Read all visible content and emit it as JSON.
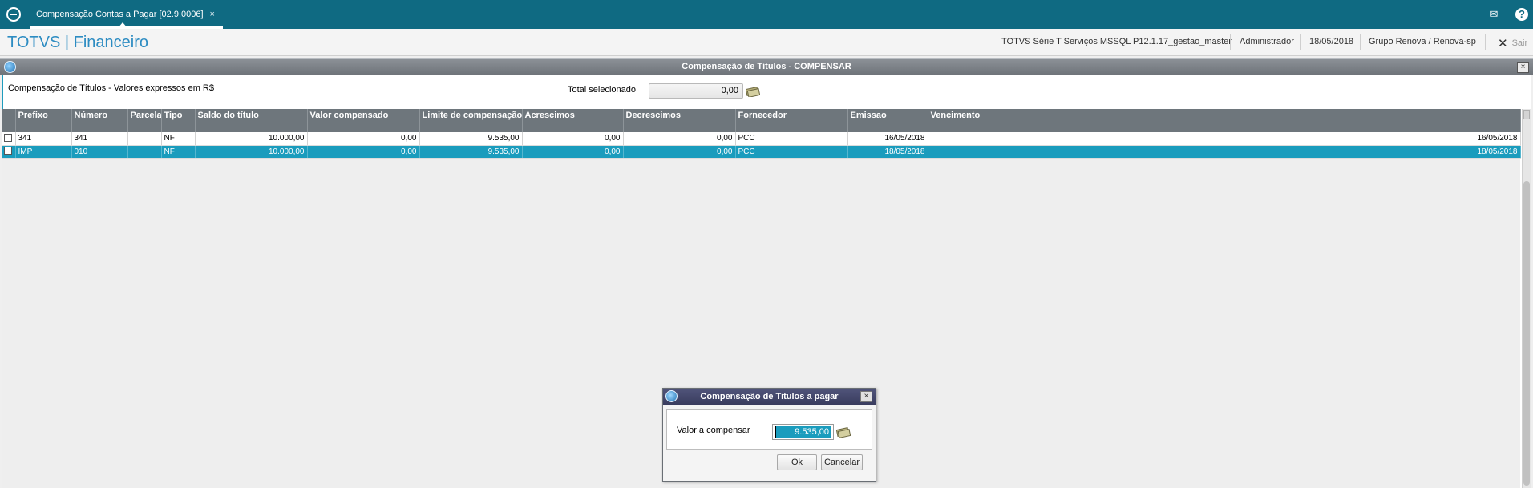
{
  "topbar": {
    "tab_label": "Compensação Contas a Pagar [02.9.0006]",
    "tab_close": "×",
    "mail_icon": "✉",
    "help_icon": "?"
  },
  "header": {
    "brand": "TOTVS | Financeiro",
    "env": "TOTVS Série T Serviços MSSQL P12.1.17_gestao_master",
    "user": "Administrador",
    "date": "18/05/2018",
    "company": "Grupo Renova / Renova-sp",
    "logout": "Sair"
  },
  "window": {
    "title": "Compensação de Títulos - COMPENSAR",
    "close": "×",
    "subtitle": "Compensação de Títulos - Valores expressos em R$",
    "total_label": "Total selecionado",
    "total_value": "0,00"
  },
  "grid": {
    "columns": [
      "Prefixo",
      "Número",
      "Parcela",
      "Tipo",
      "Saldo do título",
      "Valor compensado",
      "Limite de compensação",
      "Acrescimos",
      "Decrescimos",
      "Fornecedor",
      "Emissao",
      "Vencimento"
    ],
    "rows": [
      {
        "prefixo": "341",
        "numero": "341",
        "parcela": "",
        "tipo": "NF",
        "saldo": "10.000,00",
        "compensado": "0,00",
        "limite": "9.535,00",
        "acrescimos": "0,00",
        "decrescimos": "0,00",
        "fornecedor": "PCC",
        "emissao": "16/05/2018",
        "vencimento": "16/05/2018"
      },
      {
        "prefixo": "IMP",
        "numero": "010",
        "parcela": "",
        "tipo": "NF",
        "saldo": "10.000,00",
        "compensado": "0,00",
        "limite": "9.535,00",
        "acrescimos": "0,00",
        "decrescimos": "0,00",
        "fornecedor": "PCC",
        "emissao": "18/05/2018",
        "vencimento": "18/05/2018"
      }
    ]
  },
  "dialog": {
    "title": "Compensação de Titulos a pagar",
    "close": "×",
    "label": "Valor a compensar",
    "value": "9.535,00",
    "ok": "Ok",
    "cancel": "Cancelar"
  },
  "colors": {
    "topbar": "#0f6a82",
    "selection": "#1a9cbd",
    "header_grid": "#6e767c",
    "dialog_title": "#393c5e"
  }
}
